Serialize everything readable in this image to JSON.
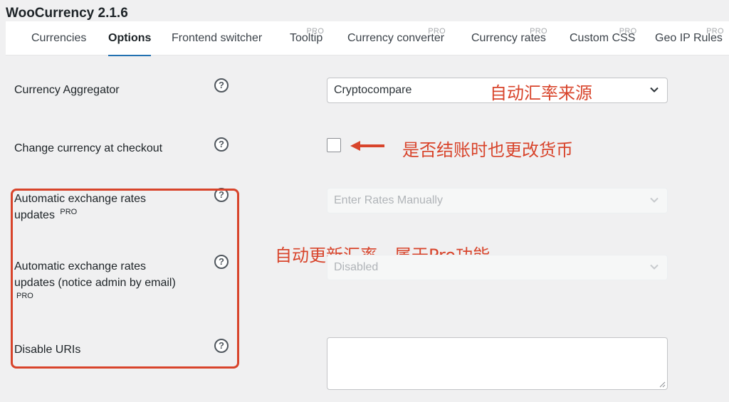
{
  "app": {
    "title": "WooCurrency 2.1.6"
  },
  "tabs": [
    {
      "label": "Currencies",
      "pro": ""
    },
    {
      "label": "Options",
      "pro": ""
    },
    {
      "label": "Frontend switcher",
      "pro": ""
    },
    {
      "label": "Tooltip",
      "pro": "PRO"
    },
    {
      "label": "Currency converter",
      "pro": "PRO"
    },
    {
      "label": "Currency rates",
      "pro": "PRO"
    },
    {
      "label": "Custom CSS",
      "pro": "PRO"
    },
    {
      "label": "Geo IP Rules",
      "pro": "PRO"
    }
  ],
  "active_tab": "Options",
  "help_glyph": "?",
  "settings": {
    "aggregator": {
      "label": "Currency Aggregator",
      "value": "Cryptocompare"
    },
    "change_at_checkout": {
      "label": "Change currency at checkout",
      "checked": false
    },
    "auto_rates": {
      "label": "Automatic exchange rates updates",
      "badge": "PRO",
      "value": "Enter Rates Manually",
      "disabled": true
    },
    "auto_rates_notice": {
      "label": "Automatic exchange rates updates (notice admin by email)",
      "badge": "PRO",
      "value": "Disabled",
      "disabled": true
    },
    "disable_uris": {
      "label": "Disable URIs",
      "value": ""
    }
  },
  "annotations": {
    "aggregator_note": "自动汇率来源",
    "checkout_note": "是否结账时也更改货币",
    "pro_note": "自动更新汇率，属于Pro功能"
  },
  "colors": {
    "accent": "#2271b1",
    "annotation_red": "#d8442b",
    "background": "#f0f0f1"
  }
}
